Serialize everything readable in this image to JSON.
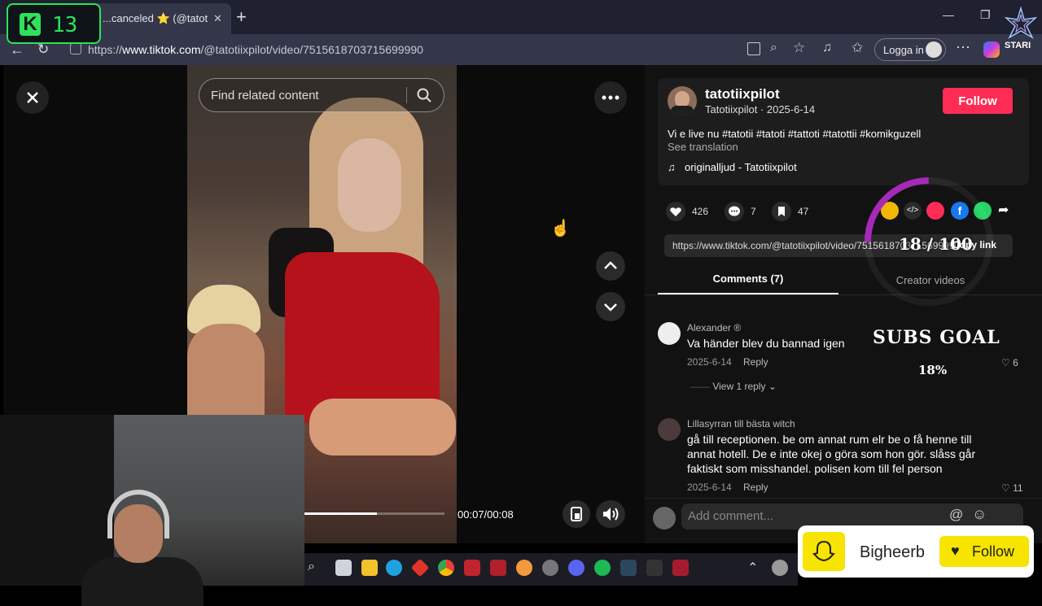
{
  "browser": {
    "tab_title": "...canceled ⭐ (@tatotii",
    "url_prefix": "https://",
    "url_host": "www.tiktok.com",
    "url_path": "/@tatotiixpilot/video/7515618703715699990",
    "login_label": "Logga in"
  },
  "video": {
    "search_placeholder": "Find related content",
    "time": "00:07/00:08",
    "progress": 0.52
  },
  "post": {
    "author_handle": "tatotiixpilot",
    "author_sub": "Tatotiixpilot · 2025-6-14",
    "follow_label": "Follow",
    "caption": "Vi e live nu #tatotii #tatoti #tattoti #tatottii #komikguzell",
    "see_translation": "See translation",
    "sound": "originalljud - Tatotiixpilot",
    "likes": "426",
    "comments": "7",
    "saves": "47",
    "link": "https://www.tiktok.com/@tatotiixpilot/video/7515618703715699990",
    "copy_link": "Copy link",
    "tab_comments": "Comments (7)",
    "tab_creator": "Creator videos"
  },
  "comments": [
    {
      "name": "Alexander ®",
      "text": "Va händer blev du bannad igen",
      "date": "2025-6-14",
      "reply": "Reply",
      "likes": "6",
      "view_replies": "View 1 reply"
    },
    {
      "name": "Lillasyrran till bästa witch",
      "text": "gå till receptionen. be om annat rum elr be o få henne till annat hotell. De e inte okej o göra som hon gör. slåss går faktiskt som misshandel. polisen kom till fel person",
      "date": "2025-6-14",
      "reply": "Reply",
      "likes": "11"
    }
  ],
  "add_comment_placeholder": "Add comment...",
  "overlay": {
    "kick_letter": "K",
    "kick_count": "13",
    "goal_count": "18 / 100",
    "goal_title": "SUBS GOAL",
    "goal_percent": "18%",
    "goal_fraction": 0.18,
    "follow_card_name": "Bigheerb",
    "follow_card_button": "Follow",
    "star_brand": "STARI"
  },
  "colors": {
    "tiktok_red": "#fe2c55",
    "kick_green": "#2ce35a",
    "follow_yellow": "#f7e400"
  }
}
